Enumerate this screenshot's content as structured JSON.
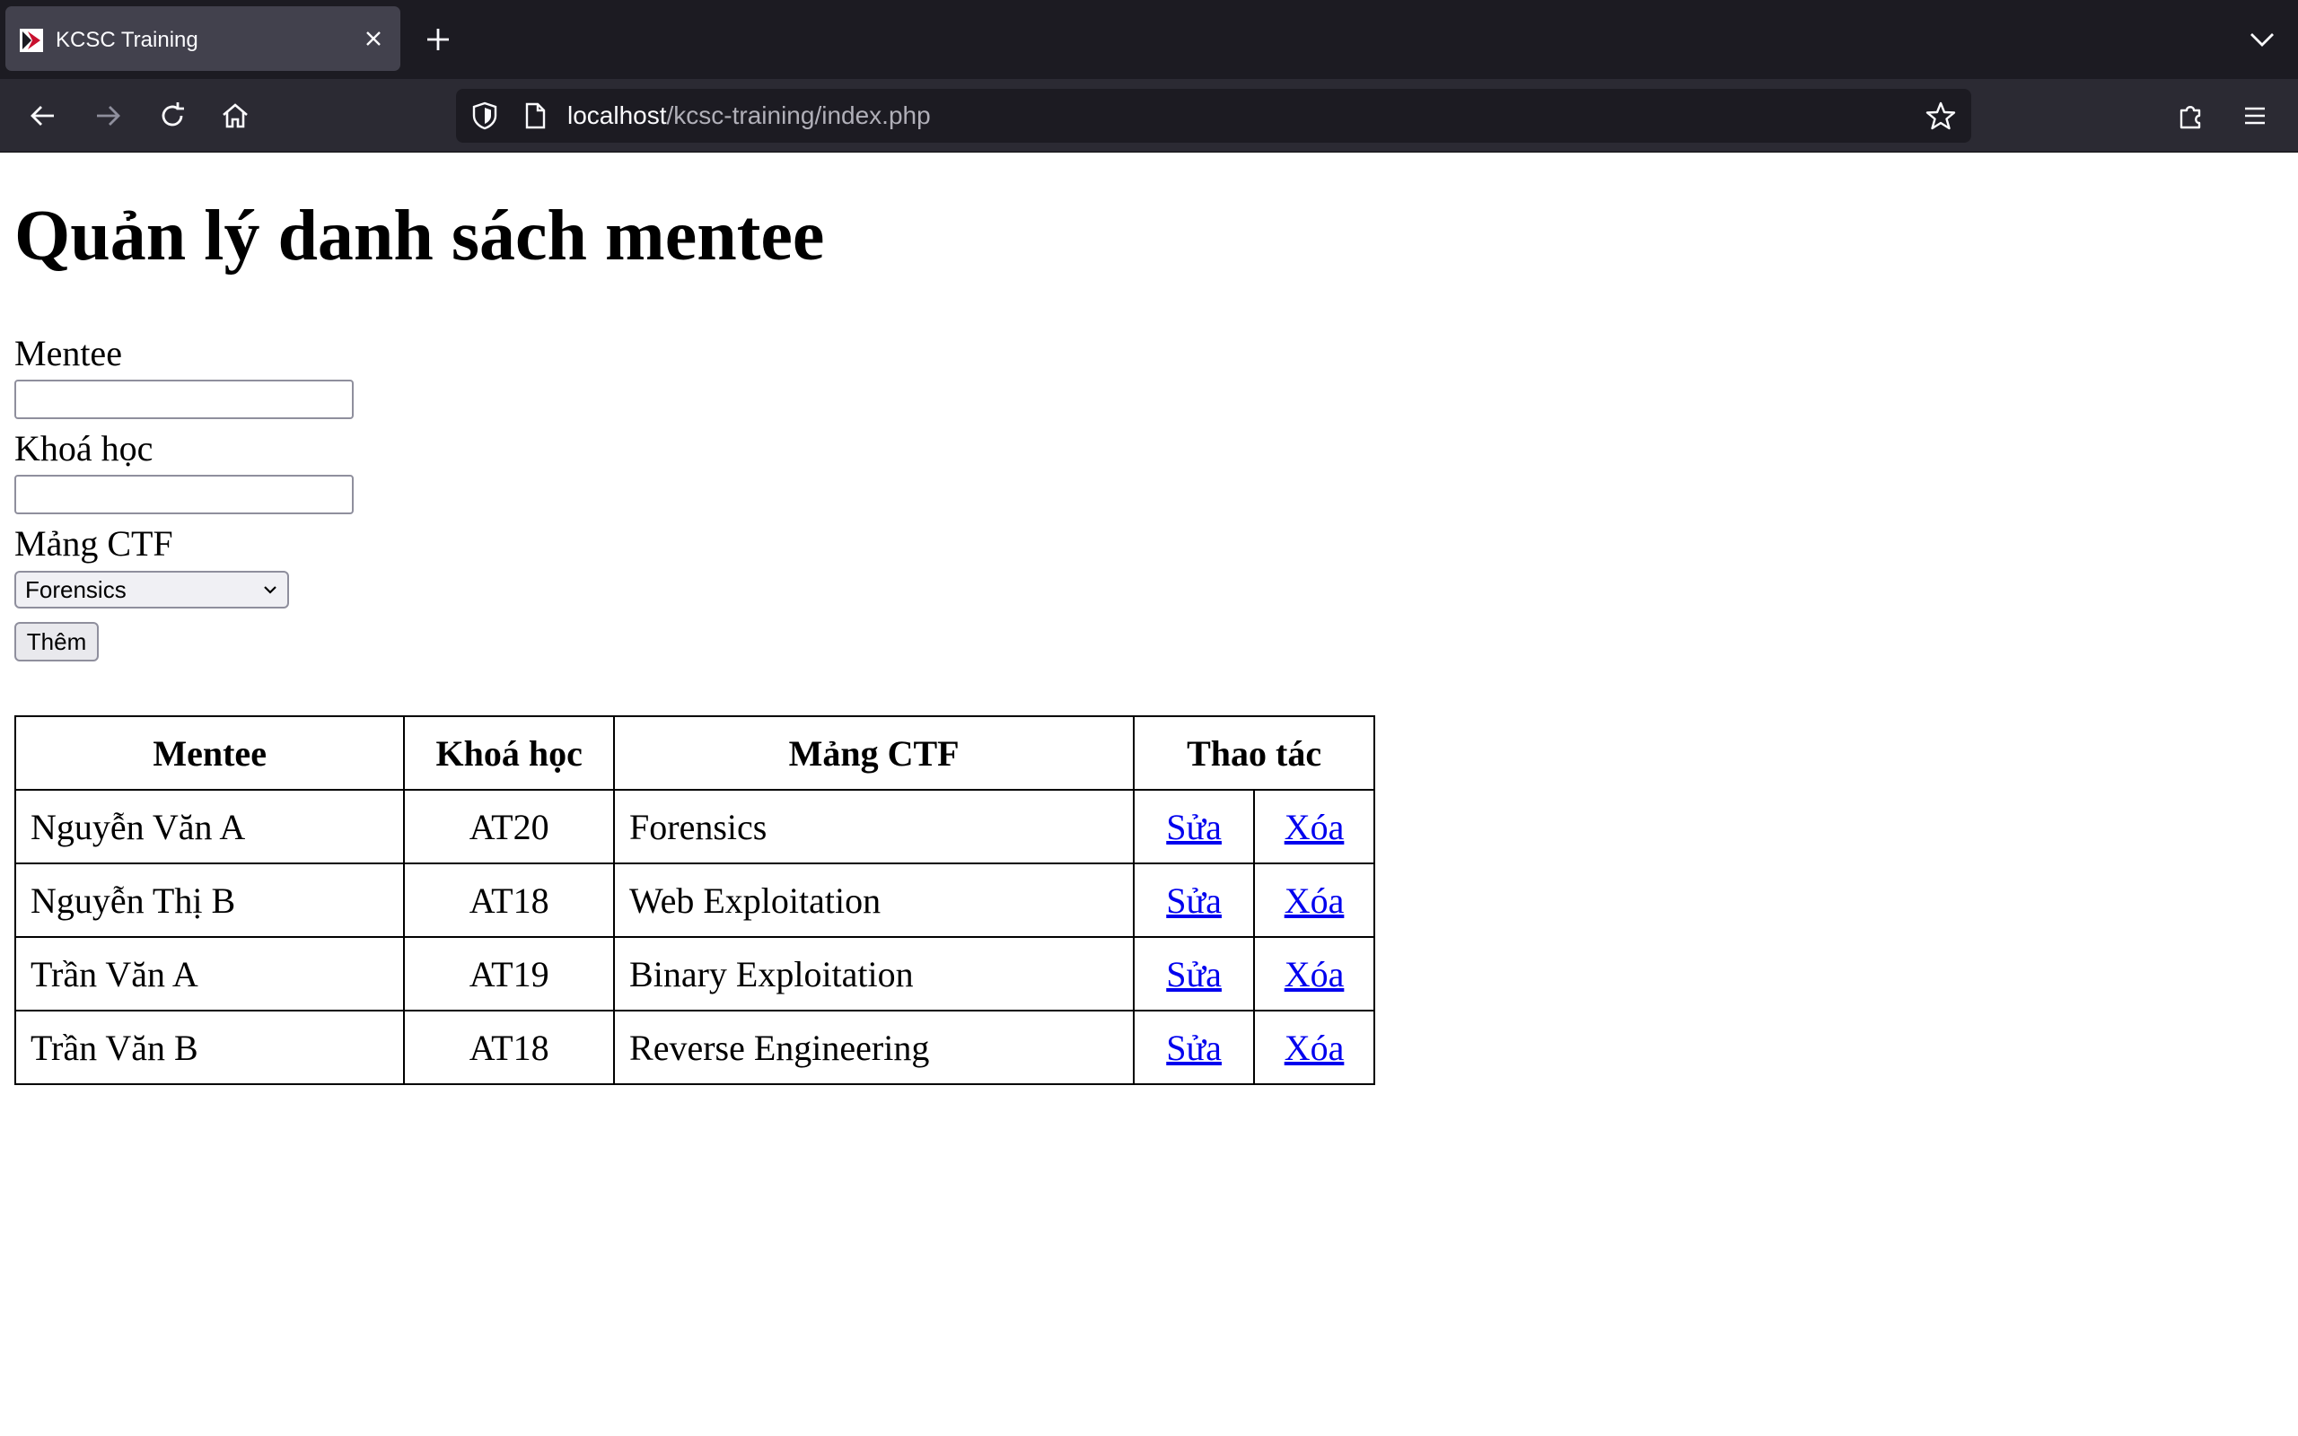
{
  "browser": {
    "tab": {
      "title": "KCSC Training"
    },
    "url": {
      "host": "localhost",
      "path": "/kcsc-training/index.php"
    }
  },
  "page": {
    "heading": "Quản lý danh sách mentee",
    "form": {
      "mentee_label": "Mentee",
      "mentee_value": "",
      "course_label": "Khoá học",
      "course_value": "",
      "ctf_label": "Mảng CTF",
      "ctf_selected": "Forensics",
      "submit_label": "Thêm"
    },
    "table": {
      "headers": {
        "mentee": "Mentee",
        "course": "Khoá học",
        "ctf": "Mảng CTF",
        "actions": "Thao tác"
      },
      "rows": [
        {
          "name": "Nguyễn Văn A",
          "course": "AT20",
          "ctf": "Forensics",
          "edit": "Sửa",
          "delete": "Xóa"
        },
        {
          "name": "Nguyễn Thị B",
          "course": "AT18",
          "ctf": "Web Exploitation",
          "edit": "Sửa",
          "delete": "Xóa"
        },
        {
          "name": "Trần Văn A",
          "course": "AT19",
          "ctf": "Binary Exploitation",
          "edit": "Sửa",
          "delete": "Xóa"
        },
        {
          "name": "Trần Văn B",
          "course": "AT18",
          "ctf": "Reverse Engineering",
          "edit": "Sửa",
          "delete": "Xóa"
        }
      ]
    }
  },
  "colors": {
    "link": "#0000ee",
    "chrome_dark": "#1c1b22",
    "toolbar": "#2b2a33"
  },
  "icons": [
    "favicon-icon",
    "close-icon",
    "plus-icon",
    "chevron-down-icon",
    "back-icon",
    "forward-icon",
    "reload-icon",
    "home-icon",
    "shield-icon",
    "page-icon",
    "star-icon",
    "extensions-icon",
    "menu-icon"
  ]
}
